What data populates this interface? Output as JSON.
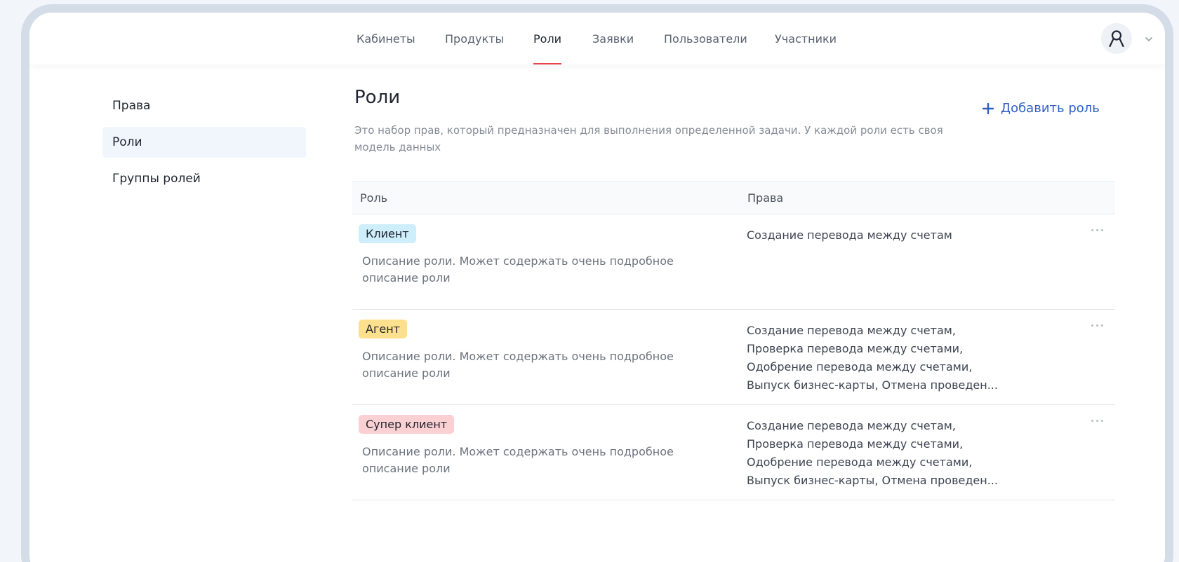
{
  "colors": {
    "accent_red": "#e8434a",
    "link_blue": "#2f5fc4",
    "badge_client": "#cdeefa",
    "badge_agent": "#fde08e",
    "badge_super": "#fbd0d2"
  },
  "nav": {
    "tabs": [
      {
        "label": "Кабинеты"
      },
      {
        "label": "Продукты"
      },
      {
        "label": "Роли"
      },
      {
        "label": "Заявки"
      },
      {
        "label": "Пользователи"
      },
      {
        "label": "Участники"
      }
    ],
    "active_tab": "Роли",
    "avatar_icon": "user-icon",
    "caret_icon": "chevron-down-icon"
  },
  "sidebar": {
    "items": [
      {
        "label": "Права"
      },
      {
        "label": "Роли"
      },
      {
        "label": "Группы ролей"
      }
    ],
    "active_item": "Роли"
  },
  "main": {
    "title": "Роли",
    "description": "Это набор прав, который предназначен для выполнения определенной задачи. У каждой роли есть своя модель данных",
    "add_button": {
      "icon": "plus-icon",
      "label": "Добавить роль"
    }
  },
  "table": {
    "headers": {
      "role": "Роль",
      "rights": "Права"
    },
    "rows": [
      {
        "badge": "Клиент",
        "description": "Описание роли. Может содержать очень  подробное описание роли",
        "rights": [
          "Создание перевода между счетам"
        ],
        "more_icon": "more-horizontal-icon"
      },
      {
        "badge": "Агент",
        "description": "Описание роли. Может содержать очень  подробное описание роли",
        "rights": [
          "Создание перевода между счетам,",
          "Проверка перевода между счетами,",
          "Одобрение перевода между счетами,",
          "Выпуск бизнес-карты, Отмена проведен..."
        ],
        "more_icon": "more-horizontal-icon"
      },
      {
        "badge": "Супер клиент",
        "description": "Описание роли. Может содержать очень  подробное описание роли",
        "rights": [
          "Создание перевода между счетам,",
          "Проверка перевода между счетами,",
          "Одобрение перевода между счетами,",
          "Выпуск бизнес-карты, Отмена проведен..."
        ],
        "more_icon": "more-horizontal-icon"
      }
    ]
  }
}
